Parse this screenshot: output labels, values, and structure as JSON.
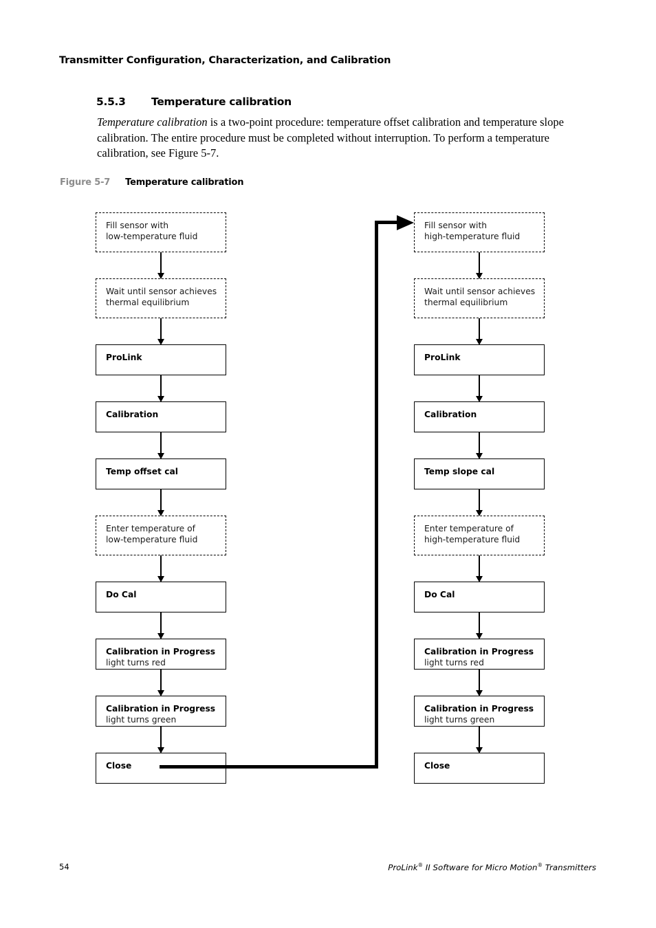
{
  "page": {
    "running_header": "Transmitter Configuration, Characterization, and Calibration",
    "footer_page_number": "54",
    "footer_title_pre": "ProLink",
    "footer_title_mid": " II Software for Micro Motion",
    "footer_title_post": " Transmitters",
    "footer_registered_mark": "®"
  },
  "section": {
    "number": "5.5.3",
    "title": "Temperature calibration",
    "paragraph_italic_lead": "Temperature calibration",
    "paragraph_rest": " is a two-point procedure: temperature offset calibration and temperature slope calibration. The entire procedure must be completed without interruption. To perform a temperature calibration, see Figure 5-7."
  },
  "figure": {
    "label": "Figure 5-7",
    "title": "Temperature calibration"
  },
  "flowchart": {
    "left_column": [
      {
        "style": "dashed",
        "line1": "Fill sensor with",
        "line2": "low-temperature fluid"
      },
      {
        "style": "dashed",
        "line1": "Wait until sensor achieves",
        "line2": "thermal equilibrium"
      },
      {
        "style": "solid",
        "line1": "ProLink",
        "line2": ""
      },
      {
        "style": "solid",
        "line1": "Calibration",
        "line2": ""
      },
      {
        "style": "solid",
        "line1": "Temp offset cal",
        "line2": ""
      },
      {
        "style": "dashed",
        "line1": "Enter temperature of",
        "line2": "low-temperature fluid"
      },
      {
        "style": "solid",
        "line1": "Do Cal",
        "line2": ""
      },
      {
        "style": "solid",
        "line1": "Calibration in Progress",
        "line2": "light turns red"
      },
      {
        "style": "solid",
        "line1": "Calibration in Progress",
        "line2": "light turns green"
      },
      {
        "style": "solid",
        "line1": "Close",
        "line2": ""
      }
    ],
    "right_column": [
      {
        "style": "dashed",
        "line1": "Fill sensor with",
        "line2": "high-temperature fluid"
      },
      {
        "style": "dashed",
        "line1": "Wait until sensor achieves",
        "line2": "thermal equilibrium"
      },
      {
        "style": "solid",
        "line1": "ProLink",
        "line2": ""
      },
      {
        "style": "solid",
        "line1": "Calibration",
        "line2": ""
      },
      {
        "style": "solid",
        "line1": "Temp slope cal",
        "line2": ""
      },
      {
        "style": "dashed",
        "line1": "Enter temperature of",
        "line2": "high-temperature fluid"
      },
      {
        "style": "solid",
        "line1": "Do Cal",
        "line2": ""
      },
      {
        "style": "solid",
        "line1": "Calibration in Progress",
        "line2": "light turns red"
      },
      {
        "style": "solid",
        "line1": "Calibration in Progress",
        "line2": "light turns green"
      },
      {
        "style": "solid",
        "line1": "Close",
        "line2": ""
      }
    ]
  },
  "colors": {
    "ink": "#000000",
    "figure_label_gray": "#8c8c8c",
    "paper": "#ffffff"
  }
}
